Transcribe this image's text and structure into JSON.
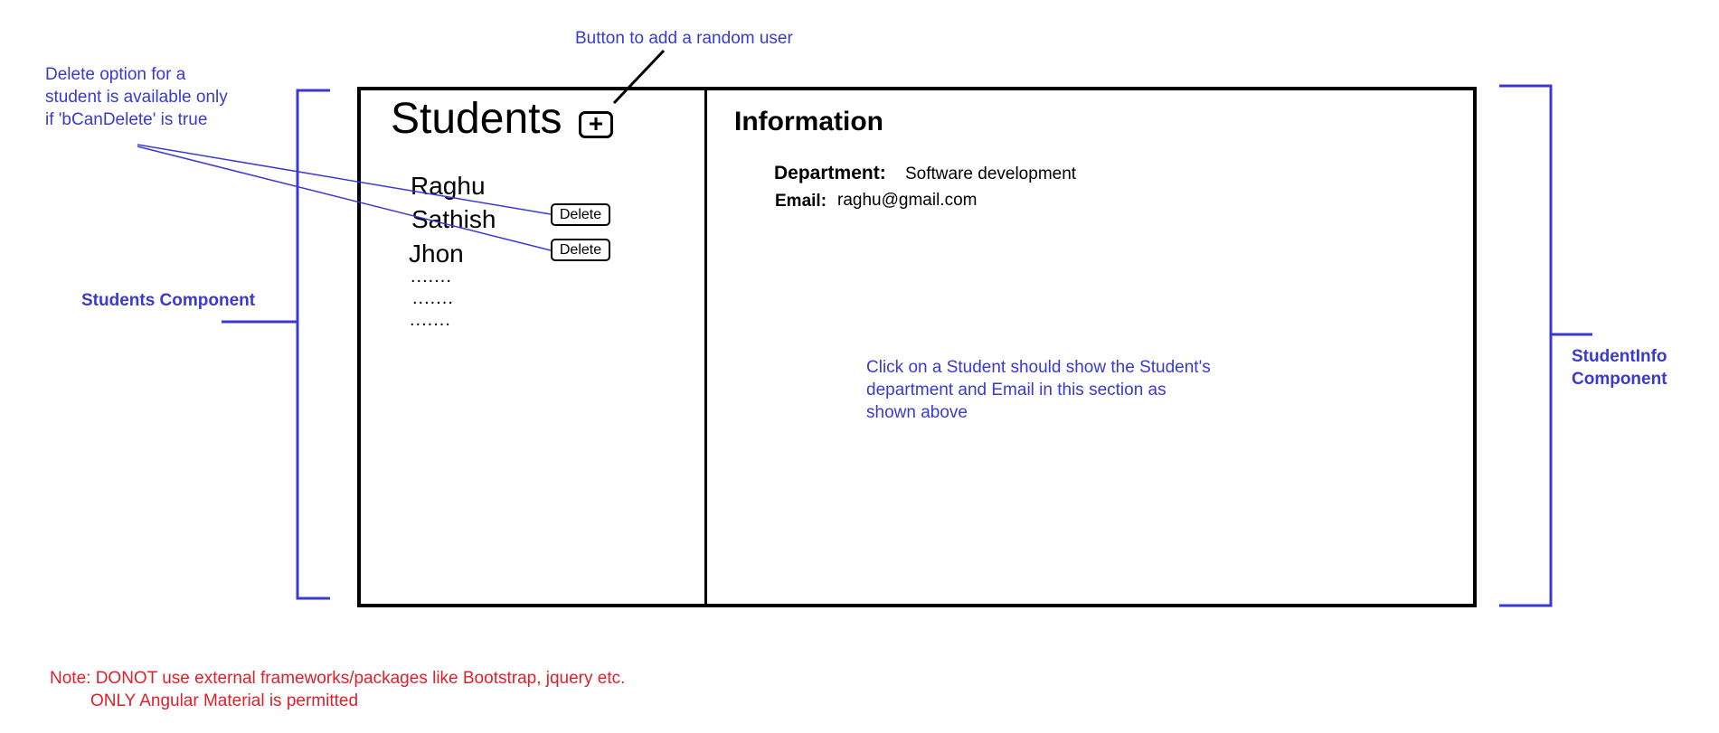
{
  "annotations": {
    "add_button_note": "Button to add a random user",
    "delete_note_lines": [
      "Delete option for a",
      "student is available only",
      "if 'bCanDelete' is true"
    ],
    "students_component": "Students Component",
    "studentinfo_component_lines": [
      "StudentInfo",
      "Component"
    ],
    "click_note_lines": [
      "Click on a Student should show the Student's",
      "department and Email in this section as",
      "shown above"
    ],
    "note_lines": [
      "Note: DONOT use external frameworks/packages like Bootstrap, jquery etc.",
      "ONLY Angular Material is permitted"
    ]
  },
  "students_panel": {
    "title": "Students",
    "add_symbol": "+",
    "names": [
      "Raghu",
      "Sathish",
      "Jhon"
    ],
    "dots": [
      ".......",
      ".......",
      "......."
    ],
    "delete_label": "Delete"
  },
  "info_panel": {
    "title": "Information",
    "department_label": "Department:",
    "department_value": "Software development",
    "email_label": "Email:",
    "email_value": "raghu@gmail.com"
  },
  "colors": {
    "annotation_blue": "#3a3ad0",
    "note_red": "#e0202a",
    "frame": "#000000"
  }
}
